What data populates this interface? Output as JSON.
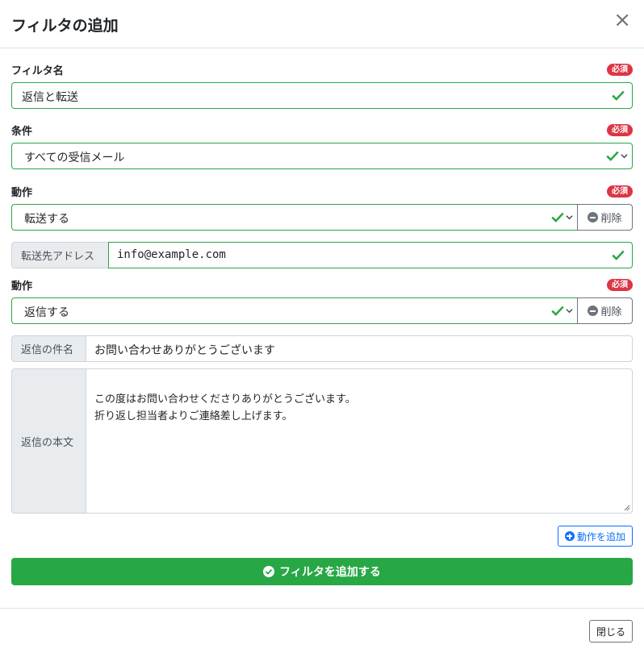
{
  "dialog": {
    "title": "フィルタの追加",
    "close_symbol": "×"
  },
  "required_badge": "必須",
  "filter_name": {
    "label": "フィルタ名",
    "value": "返信と転送"
  },
  "condition": {
    "label": "条件",
    "value": "すべての受信メール"
  },
  "actions": [
    {
      "label": "動作",
      "value": "転送する",
      "delete_label": "削除",
      "forward_address_label": "転送先アドレス",
      "forward_address_value": "info@example.com"
    },
    {
      "label": "動作",
      "value": "返信する",
      "delete_label": "削除",
      "reply_subject_label": "返信の件名",
      "reply_subject_value": "お問い合わせありがとうございます",
      "reply_body_label": "返信の本文",
      "reply_body_value": "この度はお問い合わせくださりありがとうございます。\n折り返し担当者よりご連絡差し上げます。"
    }
  ],
  "add_action_label": "動作を追加",
  "submit_label": "フィルタを追加する",
  "footer": {
    "close_label": "閉じる"
  },
  "colors": {
    "success": "#28a745",
    "danger": "#dc3545",
    "primary": "#0d6efd",
    "secondary": "#6c757d"
  }
}
